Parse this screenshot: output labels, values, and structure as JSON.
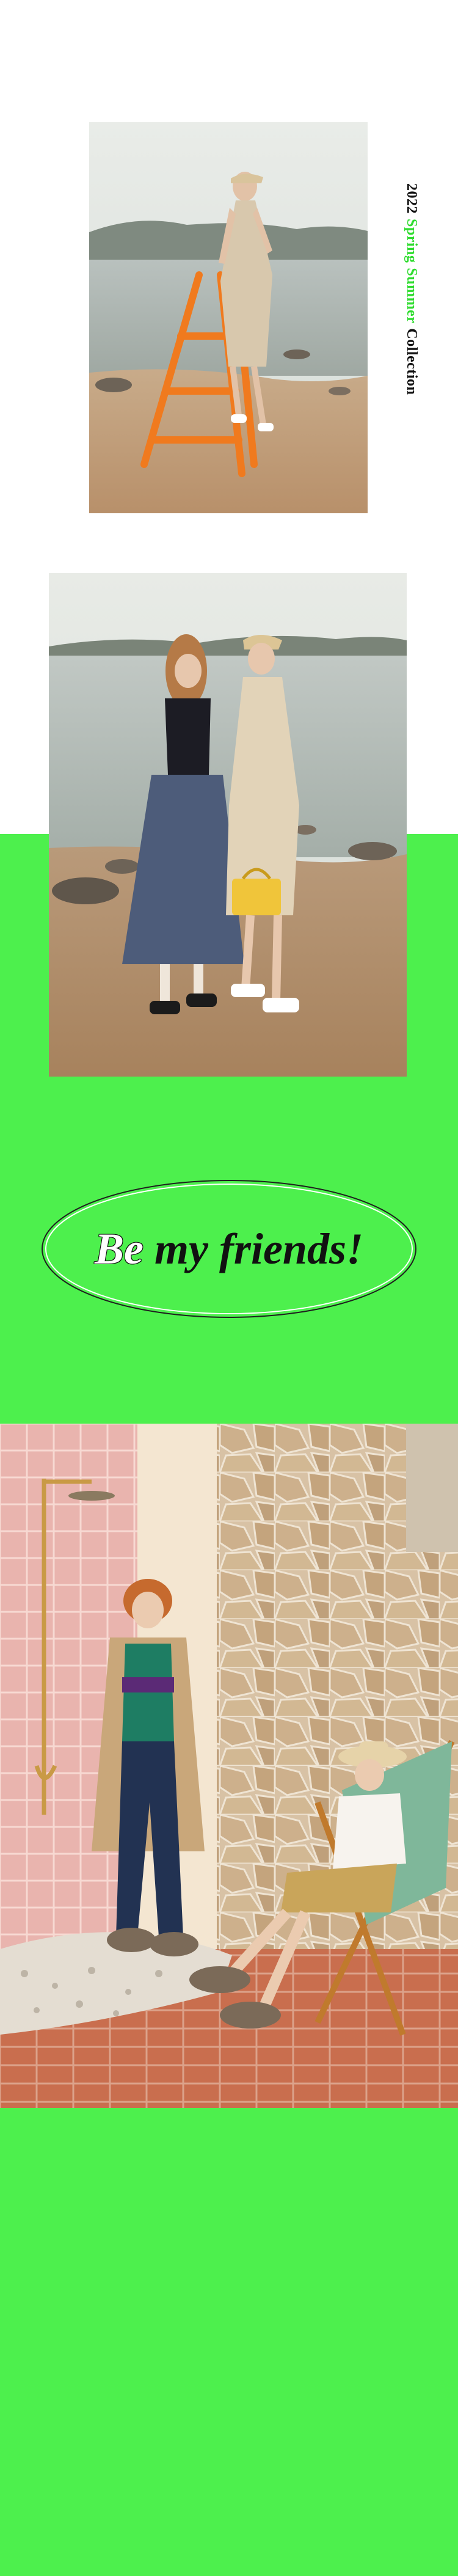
{
  "collection_title": {
    "year": "2022",
    "word_spring": "Spring",
    "word_summer": "Summer",
    "word_collection": "Collection"
  },
  "badge": {
    "word_be": "Be",
    "rest": "my friends!"
  },
  "colors": {
    "green_bg": "#4df04d",
    "accent_green": "#2fdc2f",
    "white_bg": "#ffffff"
  }
}
